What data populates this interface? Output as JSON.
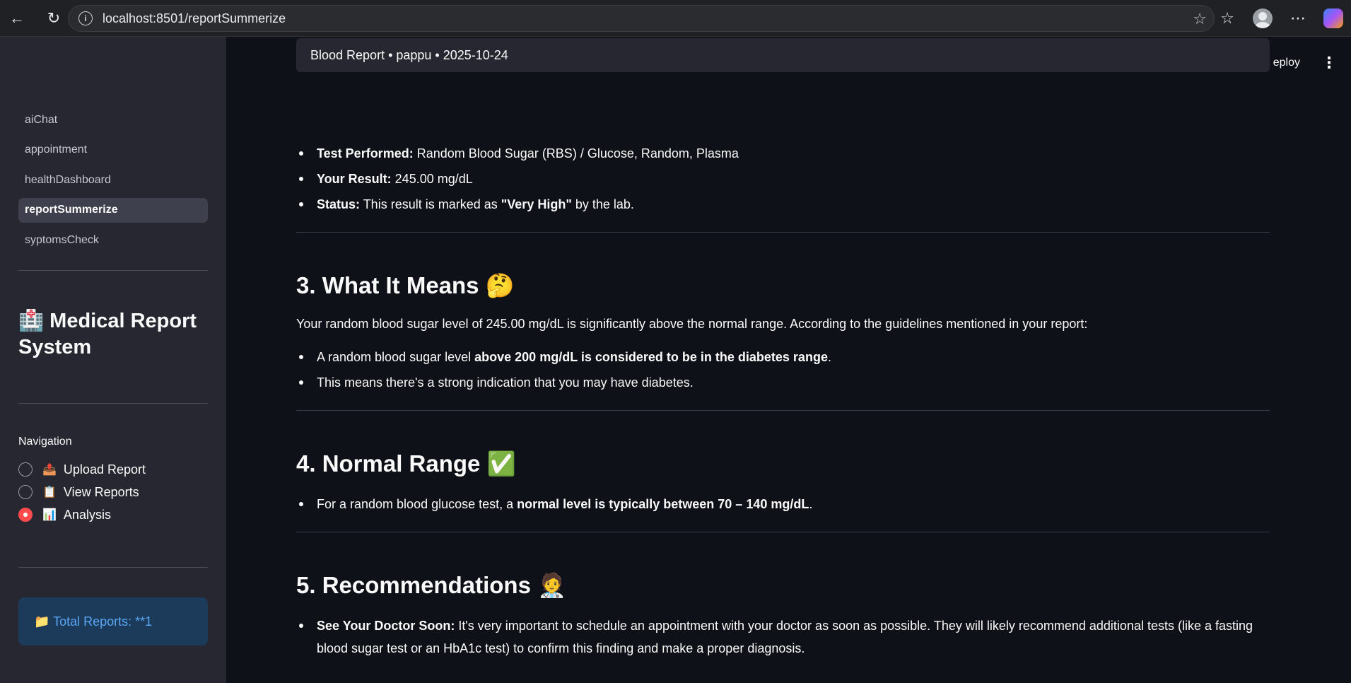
{
  "browser": {
    "url": "localhost:8501/reportSummerize"
  },
  "sidebar": {
    "pages": [
      {
        "label": "aiChat"
      },
      {
        "label": "appointment"
      },
      {
        "label": "healthDashboard"
      },
      {
        "label": "reportSummerize"
      },
      {
        "label": "syptomsCheck"
      }
    ],
    "system_title": "🏥 Medical Report System",
    "nav_label": "Navigation",
    "radio_options": [
      {
        "emoji": "📤",
        "label": "Upload Report",
        "checked": false
      },
      {
        "emoji": "📋",
        "label": "View Reports",
        "checked": false
      },
      {
        "emoji": "📊",
        "label": "Analysis",
        "checked": true
      }
    ],
    "info_box": "📁 Total Reports: **1"
  },
  "main": {
    "deploy_label": "eploy",
    "report_pill": "Blood Report • pappu • 2025-10-24",
    "results": {
      "test_label": "Test Performed:",
      "test_value": " Random Blood Sugar (RBS) / Glucose, Random, Plasma",
      "result_label": "Your Result:",
      "result_value": " 245.00 mg/dL",
      "status_label": "Status:",
      "status_value_pre": " This result is marked as ",
      "status_value_bold": "\"Very High\"",
      "status_value_post": " by the lab."
    },
    "section3": {
      "heading": "3. What It Means 🤔",
      "para": "Your random blood sugar level of 245.00 mg/dL is significantly above the normal range. According to the guidelines mentioned in your report:",
      "b1_pre": "A random blood sugar level ",
      "b1_bold": "above 200 mg/dL is considered to be in the diabetes range",
      "b1_post": ".",
      "b2": "This means there's a strong indication that you may have diabetes."
    },
    "section4": {
      "heading": "4. Normal Range ✅",
      "b1_pre": "For a random blood glucose test, a ",
      "b1_bold": "normal level is typically between 70 – 140 mg/dL",
      "b1_post": "."
    },
    "section5": {
      "heading": "5. Recommendations 🧑‍⚕️",
      "b1_bold": "See Your Doctor Soon:",
      "b1_text": " It's very important to schedule an appointment with your doctor as soon as possible. They will likely recommend additional tests (like a fasting blood sugar test or an HbA1c test) to confirm this finding and make a proper diagnosis."
    }
  }
}
